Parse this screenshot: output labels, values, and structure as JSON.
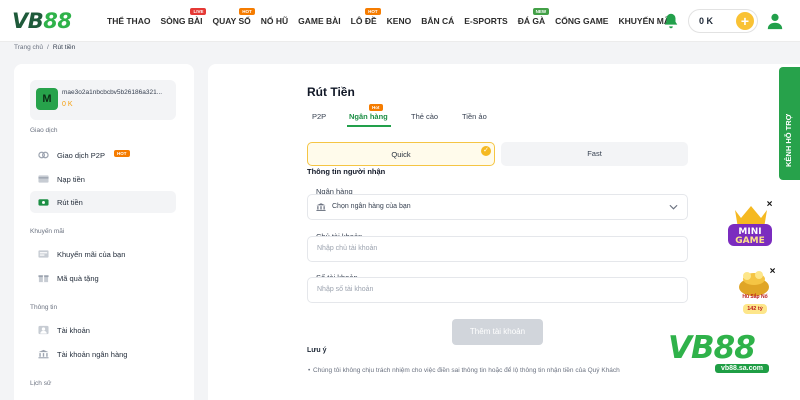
{
  "header": {
    "logo": {
      "vb": "VB",
      "n88": "88"
    },
    "menu": [
      {
        "label": "THỂ THAO",
        "badge": ""
      },
      {
        "label": "SÒNG BÀI",
        "badge": "LIVE"
      },
      {
        "label": "QUAY SỐ",
        "badge": "HOT"
      },
      {
        "label": "NỔ HŨ",
        "badge": ""
      },
      {
        "label": "GAME BÀI",
        "badge": ""
      },
      {
        "label": "LÔ ĐỀ",
        "badge": "HOT"
      },
      {
        "label": "KENO",
        "badge": ""
      },
      {
        "label": "BẮN CÁ",
        "badge": ""
      },
      {
        "label": "E-SPORTS",
        "badge": ""
      },
      {
        "label": "ĐÁ GÀ",
        "badge": "NEW"
      },
      {
        "label": "CỔNG GAME",
        "badge": ""
      },
      {
        "label": "KHUYẾN MÃI",
        "badge": ""
      }
    ],
    "balance": "0 K",
    "plus": "+"
  },
  "breadcrumb": {
    "home": "Trang chủ",
    "sep": "/",
    "current": "Rút tiền"
  },
  "sidebar": {
    "avatar_letter": "M",
    "account_id": "mae3o2a1nbcbcbv5b26186a321...",
    "account_balance": "0 K",
    "sections": [
      {
        "title": "Giao dịch",
        "items": [
          {
            "label": "Giao dịch P2P",
            "hot": "HOT",
            "icon": "p2p-icon"
          },
          {
            "label": "Nạp tiền",
            "hot": "",
            "icon": "deposit-icon"
          },
          {
            "label": "Rút tiền",
            "hot": "",
            "icon": "withdraw-icon",
            "active": true
          }
        ]
      },
      {
        "title": "Khuyến mãi",
        "items": [
          {
            "label": "Khuyến mãi của bạn",
            "hot": "",
            "icon": "promo-icon"
          },
          {
            "label": "Mã quà tặng",
            "hot": "",
            "icon": "gift-icon"
          }
        ]
      },
      {
        "title": "Thông tin",
        "items": [
          {
            "label": "Tài khoản",
            "hot": "",
            "icon": "account-icon"
          },
          {
            "label": "Tài khoản ngân hàng",
            "hot": "",
            "icon": "bank-icon"
          }
        ]
      },
      {
        "title": "Lịch sử",
        "items": []
      }
    ]
  },
  "main": {
    "title": "Rút Tiền",
    "tabs": [
      "P2P",
      "Ngân hàng",
      "Thẻ cào",
      "Tiền ảo"
    ],
    "tab_hot": "Hot",
    "active_tab": 1,
    "modes": {
      "quick": "Quick",
      "fast": "Fast"
    },
    "receiver_title": "Thông tin người nhận",
    "bank_label": "Ngân hàng",
    "bank_placeholder": "Chọn ngân hàng của bạn",
    "owner_label": "Chủ tài khoản",
    "owner_placeholder": "Nhập chủ tài khoản",
    "number_label": "Số tài khoản",
    "number_placeholder": "Nhập số tài khoản",
    "add_button": "Thêm tài khoản",
    "note_title": "Lưu ý",
    "note_text": "Chúng tôi không chịu trách nhiệm cho việc điền sai thông tin hoặc để lộ thông tin nhận tiền của Quý Khách"
  },
  "floating": {
    "support": "KÊNH HỖ TRỢ",
    "close": "×",
    "jackpot_label": "Hũ Sắp Nổ",
    "jackpot_value": "142 tỷ",
    "watermark": {
      "vb": "VB",
      "n88": "88",
      "url": "vb88.sa.com"
    }
  },
  "colors": {
    "brand_green": "#27a24b",
    "accent_gold": "#f5c544",
    "hot": "#f57c00",
    "live": "#e53935"
  }
}
